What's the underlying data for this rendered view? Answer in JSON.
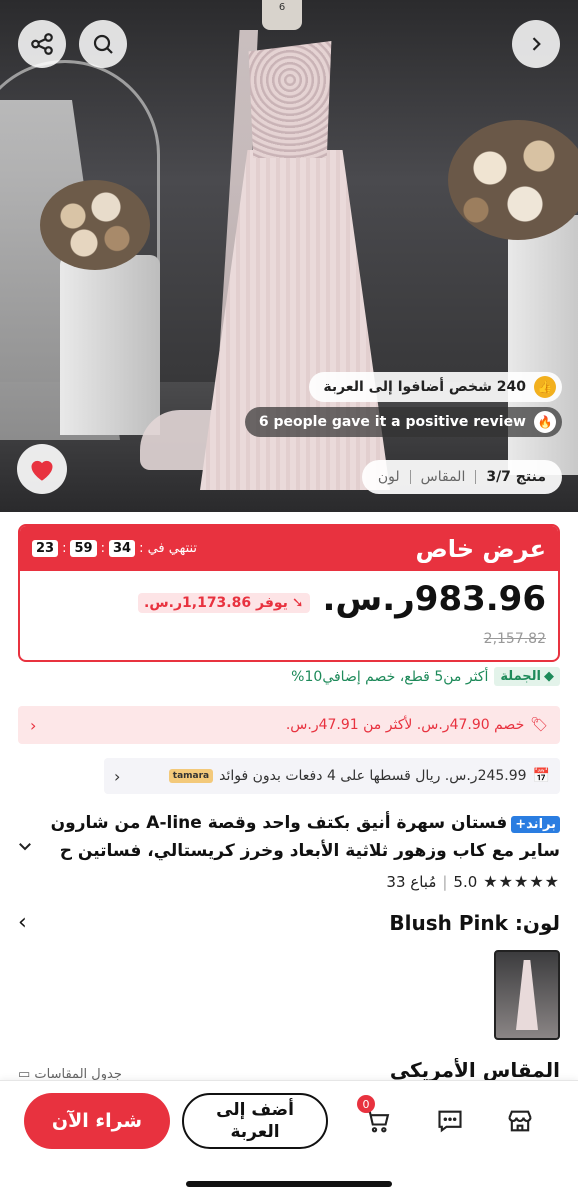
{
  "hero": {
    "mannequin_tag": "6",
    "cart_adds": "240 شخص أضافوا إلى العربة",
    "reviews_pill": "6 people gave it a positive review",
    "counter": {
      "product_label": "منتج 3/7",
      "size_label": "المقاس",
      "color_label": "لون"
    }
  },
  "deal": {
    "title": "عرض خاص",
    "ends_in": "تنتهي في :",
    "timer": {
      "h": "23",
      "m": "59",
      "s": "34"
    },
    "price": "983.96ر.س.",
    "save": "يوفر 1,173.86ر.س.",
    "old_price": "2,157.82"
  },
  "wholesale": {
    "tag": "الجملة",
    "text": "أكثر من5 قطع، خصم إضافي10%"
  },
  "coupon": {
    "text": "خصم 47.90ر.س. لأكثر من 47.91ر.س."
  },
  "tamara": {
    "text": "245.99ر.س. ريال قسطها على 4 دفعات بدون فوائد",
    "logo": "tamara"
  },
  "product": {
    "brand": "براند+",
    "title_line1": "فستان سهرة أنيق بكتف واحد وقصة A-line من شارون",
    "title_line2": "ساير مع كاب وزهور ثلاثية الأبعاد وخرز كريستالي، فساتين ح",
    "rating": "5.0",
    "sold": "33 مُباع"
  },
  "color": {
    "label": "لون:",
    "value": "Blush Pink"
  },
  "size": {
    "label": "المقاس الأمريكي",
    "chart_link": "جدول المقاسات"
  },
  "bottom": {
    "buy_now": "شراء الآن",
    "add_to_cart": "أضف إلى العربة",
    "cart_count": "0"
  },
  "colors": {
    "accent": "#e8323f",
    "green": "#1e8a5a"
  }
}
